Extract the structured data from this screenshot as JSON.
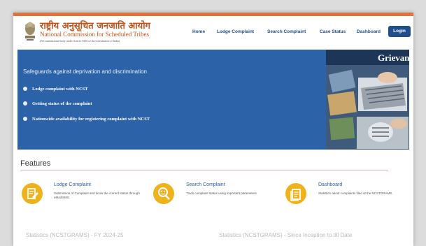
{
  "header": {
    "title_hindi": "राष्ट्रीय अनुसूचित जनजाति आयोग",
    "title_english": "National Commission for Scheduled Tribes",
    "subtitle": "(A Constitutional body under Article 338A of the Constitution of India)"
  },
  "nav": {
    "home": "Home",
    "lodge": "Lodge Complaint",
    "search": "Search Complaint",
    "case": "Case Status",
    "dashboard": "Dashboard",
    "login": "Login"
  },
  "hero": {
    "tagline": "Safeguards against deprivation and discrimination",
    "bullets": [
      "Lodge complaint with NCST",
      "Getting status of the complaint",
      "Nationwide availability for registering complaint with NCST"
    ],
    "banner_text": "Grievan"
  },
  "features": {
    "heading": "Features",
    "items": [
      {
        "title": "Lodge Complaint",
        "desc": "Submission of Complaint and know the current status through eMail/SMS."
      },
      {
        "title": "Search Complaint",
        "desc": "Track complaint status using important parameters"
      },
      {
        "title": "Dashboard",
        "desc": "Statistics about complaints filed at the NCSTGRAMS."
      }
    ]
  },
  "stats": {
    "left": "Statistics (NCSTGRAMS) - FY 2024-25",
    "right": "Statistics (NCSTGRAMS) - Since Inception to till Date"
  },
  "colors": {
    "accent_orange": "#e0733a",
    "hero_blue": "#2c63a8",
    "nav_blue": "#1e4f8c",
    "feature_yellow": "#efb21b"
  }
}
